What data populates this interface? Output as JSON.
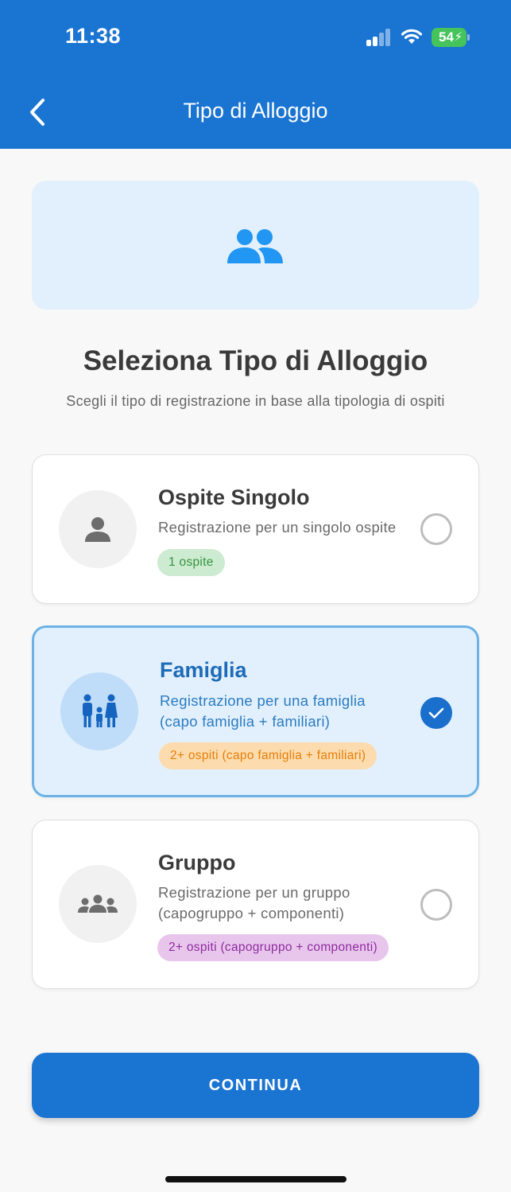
{
  "status_bar": {
    "time": "11:38",
    "battery": "54"
  },
  "header": {
    "title": "Tipo di Alloggio",
    "back_icon": "chevron-left-icon"
  },
  "hero": {
    "icon": "people-icon",
    "icon_color": "#2196f3"
  },
  "main": {
    "title": "Seleziona Tipo di Alloggio",
    "subtitle": "Scegli il tipo di registrazione in base alla tipologia di ospiti"
  },
  "options": [
    {
      "title": "Ospite Singolo",
      "description_lines": [
        "Registrazione per un singolo ospite"
      ],
      "badge": "1 ospite",
      "icon": "person-icon",
      "selected": false
    },
    {
      "title": "Famiglia",
      "description_lines": [
        "Registrazione per una famiglia",
        "(capo famiglia + familiari)"
      ],
      "badge": "2+ ospiti (capo famiglia + familiari)",
      "icon": "family-icon",
      "selected": true
    },
    {
      "title": "Gruppo",
      "description_lines": [
        "Registrazione per un gruppo",
        "(capogruppo + componenti)"
      ],
      "badge": "2+ ospiti (capogruppo + componenti)",
      "icon": "group-icon",
      "selected": false
    }
  ],
  "actions": {
    "continue_label": "CONTINUA"
  },
  "colors": {
    "primary": "#1a74d2",
    "selected_bg": "#e2f0fd",
    "badge_green": "#37923f",
    "badge_orange": "#e67e0c",
    "badge_purple": "#8f2aa0"
  }
}
